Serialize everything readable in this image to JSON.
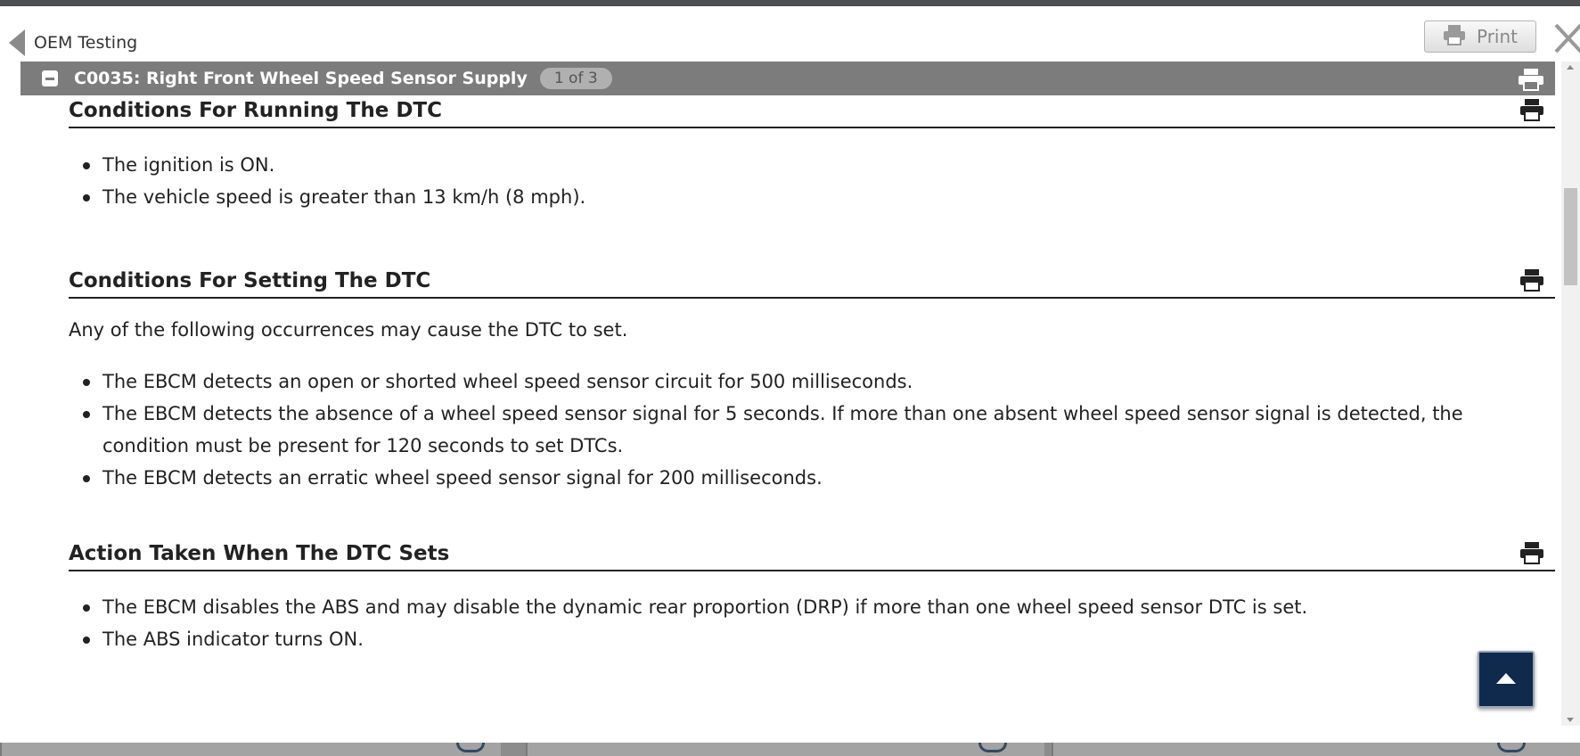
{
  "header": {
    "back_label": "OEM Testing",
    "print_label": "Print"
  },
  "section_bar": {
    "title": "C0035: Right Front Wheel Speed Sensor Supply",
    "page_badge": "1 of 3"
  },
  "sections": {
    "running": {
      "heading": "Conditions For Running The DTC",
      "bullets": [
        "The ignition is ON.",
        "The vehicle speed is greater than 13 km/h (8 mph)."
      ]
    },
    "setting": {
      "heading": "Conditions For Setting The DTC",
      "intro": "Any of the following occurrences may cause the DTC to set.",
      "bullets": [
        "The EBCM detects an open or shorted wheel speed sensor circuit for 500 milliseconds.",
        "The EBCM detects the absence of a wheel speed sensor signal for 5 seconds. If more than one absent wheel speed sensor signal is detected, the condition must be present for 120 seconds to set DTCs.",
        "The EBCM detects an erratic wheel speed sensor signal for 200 milliseconds."
      ]
    },
    "action": {
      "heading": "Action Taken When The DTC Sets",
      "bullets": [
        "The EBCM disables the ABS and may disable the dynamic rear proportion (DRP) if more than one wheel speed sensor DTC is set.",
        "The ABS indicator turns ON."
      ]
    }
  },
  "icons": {
    "back": "back-arrow-icon",
    "print": "printer-icon",
    "close": "close-icon",
    "collapse": "collapse-minus-icon",
    "scroll_top": "arrow-up-icon"
  },
  "colors": {
    "section_bar": "#7c7c7c",
    "top_button": "#0f2a4d"
  }
}
